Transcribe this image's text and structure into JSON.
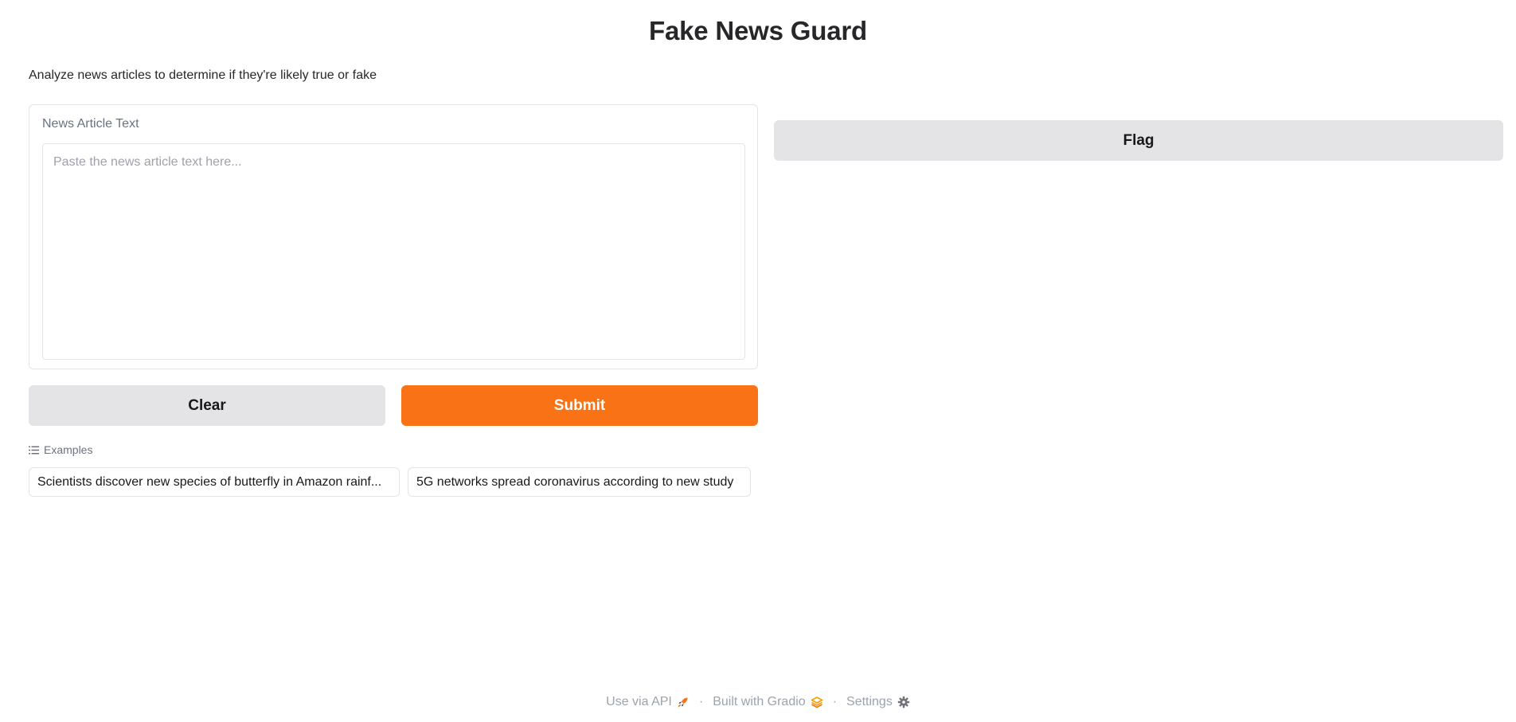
{
  "app": {
    "title": "Fake News Guard",
    "description": "Analyze news articles to determine if they're likely true or fake"
  },
  "input": {
    "label": "News Article Text",
    "placeholder": "Paste the news article text here...",
    "value": ""
  },
  "buttons": {
    "clear_label": "Clear",
    "submit_label": "Submit",
    "flag_label": "Flag"
  },
  "examples": {
    "header": "Examples",
    "icon": "list-icon",
    "items": [
      {
        "label": "Scientists discover new species of butterfly in Amazon rainf..."
      },
      {
        "label": "5G networks spread coronavirus according to new study"
      }
    ]
  },
  "footer": {
    "api_label": "Use via API",
    "api_icon": "rocket-icon",
    "built_label": "Built with Gradio",
    "built_icon": "gradio-logo-icon",
    "settings_label": "Settings",
    "settings_icon": "gear-icon",
    "separator": "·"
  },
  "colors": {
    "accent": "#f97316",
    "secondary_button": "#e4e4e7",
    "border": "#e4e4e7",
    "muted_text": "#9ca3af"
  }
}
